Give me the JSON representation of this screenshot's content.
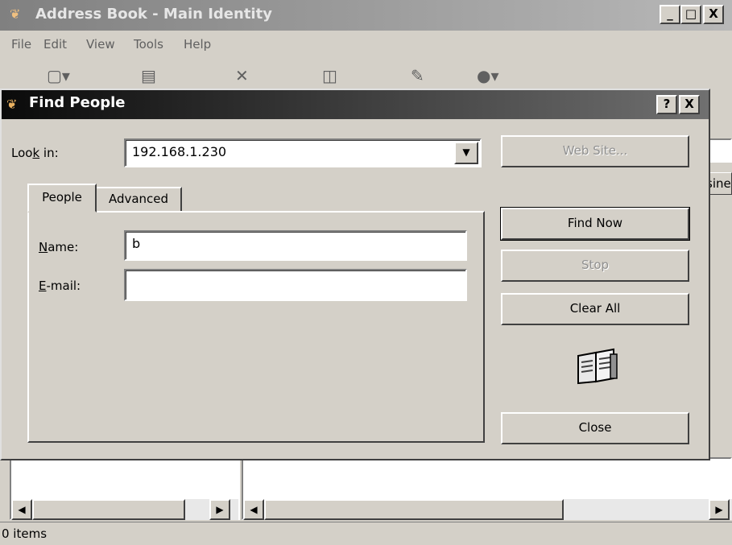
{
  "main_window": {
    "title": "Address Book - Main Identity",
    "caption_buttons": [
      "_",
      "□",
      "X"
    ],
    "menu": [
      "File",
      "Edit",
      "View",
      "Tools",
      "Help"
    ],
    "toolbar_icons": [
      "new-contact-icon",
      "properties-icon",
      "delete-icon",
      "find-people-icon",
      "print-icon",
      "action-icon"
    ],
    "column_header_fragment": "sine",
    "status": "0 items"
  },
  "dialog": {
    "title": "Find People",
    "help_button": "?",
    "close_button": "X",
    "look_in_label": "Look in:",
    "look_in_value": "192.168.1.230",
    "web_site_button": "Web Site...",
    "tabs": [
      "People",
      "Advanced"
    ],
    "active_tab": "People",
    "name_label": "Name:",
    "name_value": "b",
    "email_label": "E-mail:",
    "email_value": "",
    "find_now_button": "Find Now",
    "stop_button": "Stop",
    "clear_all_button": "Clear All",
    "close_dialog_button": "Close",
    "illustration_icon": "address-book-icon"
  }
}
